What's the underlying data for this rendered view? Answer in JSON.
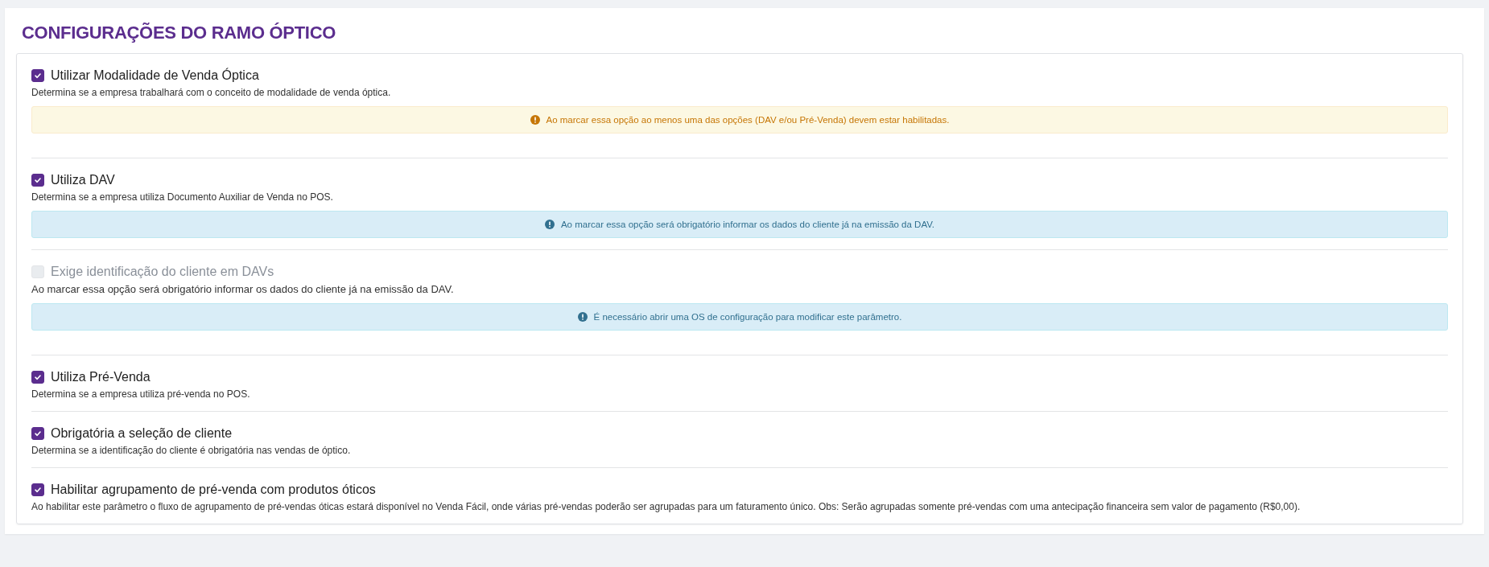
{
  "title": "CONFIGURAÇÕES DO RAMO ÓPTICO",
  "settings": [
    {
      "label": "Utilizar Modalidade de Venda Óptica",
      "checked": true,
      "disabled": false,
      "description": "Determina se a empresa trabalhará com o conceito de modalidade de venda óptica.",
      "alert": {
        "kind": "warning",
        "text": "Ao marcar essa opção ao menos uma das opções (DAV e/ou Pré-Venda) devem estar habilitadas."
      }
    },
    {
      "label": "Utiliza DAV",
      "checked": true,
      "disabled": false,
      "description": "Determina se a empresa utiliza Documento Auxiliar de Venda no POS.",
      "alert": {
        "kind": "info",
        "text": "Ao marcar essa opção será obrigatório informar os dados do cliente já na emissão da DAV."
      }
    },
    {
      "label": "Exige identificação do cliente em DAVs",
      "checked": false,
      "disabled": true,
      "description": "Ao marcar essa opção será obrigatório informar os dados do cliente já na emissão da DAV.",
      "alert": {
        "kind": "info",
        "text": "É necessário abrir uma OS de configuração para modificar este parâmetro."
      }
    },
    {
      "label": "Utiliza Pré-Venda",
      "checked": true,
      "disabled": false,
      "description": "Determina se a empresa utiliza pré-venda no POS."
    },
    {
      "label": "Obrigatória a seleção de cliente",
      "checked": true,
      "disabled": false,
      "description": "Determina se a identificação do cliente é obrigatória nas vendas de óptico."
    },
    {
      "label": "Habilitar agrupamento de pré-venda com produtos óticos",
      "checked": true,
      "disabled": false,
      "description": "Ao habilitar este parâmetro o fluxo de agrupamento de pré-vendas óticas estará disponível no Venda Fácil, onde várias pré-vendas poderão ser agrupadas para um faturamento único. Obs: Serão agrupadas somente pré-vendas com uma antecipação financeira sem valor de pagamento (R$0,00)."
    }
  ]
}
